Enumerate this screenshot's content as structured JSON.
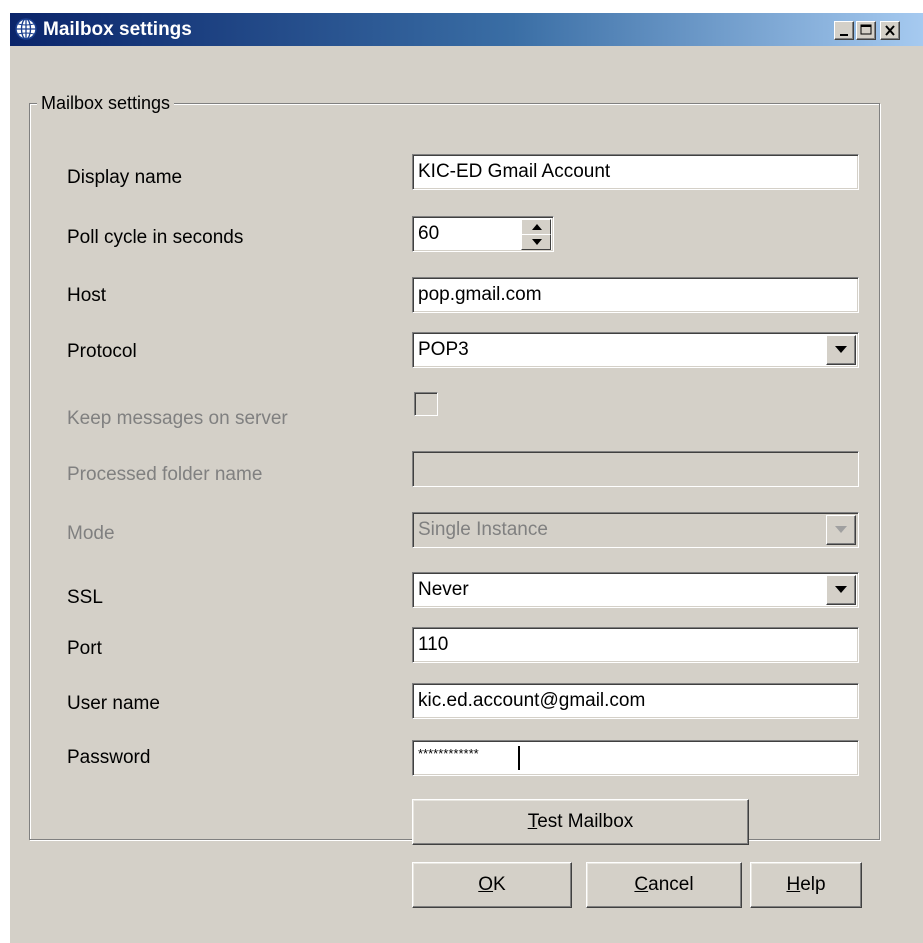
{
  "window": {
    "title": "Mailbox settings",
    "controls": [
      "minimize",
      "maximize",
      "close"
    ]
  },
  "group": {
    "label": "Mailbox settings"
  },
  "fields": {
    "display_name": {
      "label": "Display name",
      "value": "KIC-ED Gmail Account"
    },
    "poll_cycle": {
      "label": "Poll cycle in seconds",
      "value": "60"
    },
    "host": {
      "label": "Host",
      "value": "pop.gmail.com"
    },
    "protocol": {
      "label": "Protocol",
      "value": "POP3"
    },
    "keep_messages": {
      "label": "Keep messages on server",
      "checked": false,
      "enabled": false
    },
    "processed_folder": {
      "label": "Processed folder name",
      "value": "",
      "enabled": false
    },
    "mode": {
      "label": "Mode",
      "value": "Single Instance",
      "enabled": false
    },
    "ssl": {
      "label": "SSL",
      "value": "Never"
    },
    "port": {
      "label": "Port",
      "value": "110"
    },
    "user_name": {
      "label": "User name",
      "value": "kic.ed.account@gmail.com"
    },
    "password": {
      "label": "Password",
      "value": "************"
    }
  },
  "buttons": {
    "test_mailbox": {
      "accel": "T",
      "rest": "est Mailbox"
    },
    "ok": {
      "accel": "O",
      "rest": "K"
    },
    "cancel": {
      "accel": "C",
      "rest": "ancel"
    },
    "help": {
      "accel": "H",
      "rest": "elp"
    }
  },
  "colors": {
    "face": "#d4d0c8",
    "title_start": "#0a246a",
    "title_end": "#a6caf0",
    "disabled_text": "#808080"
  }
}
